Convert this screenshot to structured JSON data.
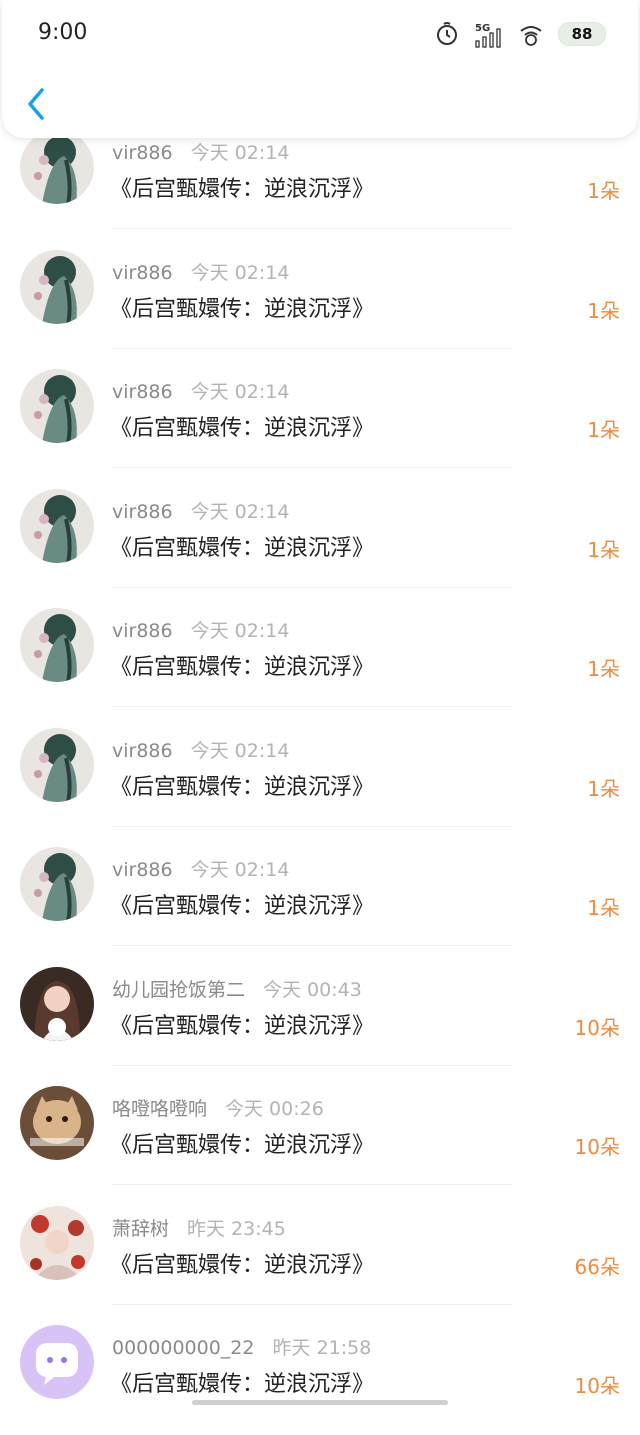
{
  "status_bar": {
    "time": "9:00",
    "network": "5G",
    "battery": "88"
  },
  "colors": {
    "accent": "#1aa0e8",
    "amount": "#f08a3c"
  },
  "header": {
    "back_icon": "chevron-left-icon"
  },
  "gifts": [
    {
      "user": "vir886",
      "time": "今天 02:14",
      "title": "《后宫甄嬛传：逆浪沉浮》",
      "amount": "1朵",
      "avatar": "a"
    },
    {
      "user": "vir886",
      "time": "今天 02:14",
      "title": "《后宫甄嬛传：逆浪沉浮》",
      "amount": "1朵",
      "avatar": "a"
    },
    {
      "user": "vir886",
      "time": "今天 02:14",
      "title": "《后宫甄嬛传：逆浪沉浮》",
      "amount": "1朵",
      "avatar": "a"
    },
    {
      "user": "vir886",
      "time": "今天 02:14",
      "title": "《后宫甄嬛传：逆浪沉浮》",
      "amount": "1朵",
      "avatar": "a"
    },
    {
      "user": "vir886",
      "time": "今天 02:14",
      "title": "《后宫甄嬛传：逆浪沉浮》",
      "amount": "1朵",
      "avatar": "a"
    },
    {
      "user": "vir886",
      "time": "今天 02:14",
      "title": "《后宫甄嬛传：逆浪沉浮》",
      "amount": "1朵",
      "avatar": "a"
    },
    {
      "user": "vir886",
      "time": "今天 02:14",
      "title": "《后宫甄嬛传：逆浪沉浮》",
      "amount": "1朵",
      "avatar": "a"
    },
    {
      "user": "幼儿园抢饭第二",
      "time": "今天 00:43",
      "title": "《后宫甄嬛传：逆浪沉浮》",
      "amount": "10朵",
      "avatar": "b"
    },
    {
      "user": "咯噔咯噔响",
      "time": "今天 00:26",
      "title": "《后宫甄嬛传：逆浪沉浮》",
      "amount": "10朵",
      "avatar": "c"
    },
    {
      "user": "萧辞树",
      "time": "昨天 23:45",
      "title": "《后宫甄嬛传：逆浪沉浮》",
      "amount": "66朵",
      "avatar": "d"
    },
    {
      "user": "000000000_22",
      "time": "昨天 21:58",
      "title": "《后宫甄嬛传：逆浪沉浮》",
      "amount": "10朵",
      "avatar": "e"
    }
  ]
}
